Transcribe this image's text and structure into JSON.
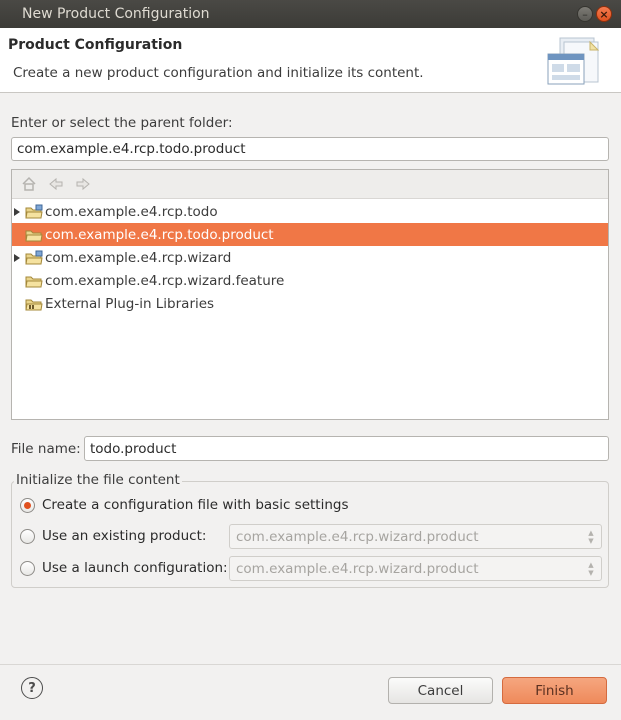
{
  "window": {
    "title": "New Product Configuration",
    "minimize_glyph": "–",
    "close_glyph": "×"
  },
  "header": {
    "title": "Product Configuration",
    "description": "Create a new product configuration and initialize its content.",
    "icon": "wizard-banner-icon"
  },
  "parent_folder": {
    "label": "Enter or select the parent folder:",
    "value": "com.example.e4.rcp.todo.product"
  },
  "tree": {
    "toolbar": [
      "home-icon",
      "back-arrow-icon",
      "forward-arrow-icon"
    ],
    "items": [
      {
        "label": "com.example.e4.rcp.todo",
        "expandable": true,
        "selected": false,
        "icon": "project-folder-icon"
      },
      {
        "label": "com.example.e4.rcp.todo.product",
        "expandable": false,
        "selected": true,
        "icon": "project-folder-icon"
      },
      {
        "label": "com.example.e4.rcp.wizard",
        "expandable": true,
        "selected": false,
        "icon": "project-folder-icon"
      },
      {
        "label": "com.example.e4.rcp.wizard.feature",
        "expandable": false,
        "selected": false,
        "icon": "project-folder-icon"
      },
      {
        "label": "External Plug-in Libraries",
        "expandable": false,
        "selected": false,
        "icon": "library-folder-icon"
      }
    ]
  },
  "file_name": {
    "label": "File name:",
    "value": "todo.product"
  },
  "init_group": {
    "legend": "Initialize the file content",
    "options": [
      {
        "label": "Create a configuration file with basic settings",
        "checked": true
      },
      {
        "label": "Use an existing product:",
        "checked": false,
        "combo_value": "com.example.e4.rcp.wizard.product"
      },
      {
        "label": "Use a launch configuration:",
        "checked": false,
        "combo_value": "com.example.e4.rcp.wizard.product"
      }
    ]
  },
  "footer": {
    "help_glyph": "?",
    "cancel_label": "Cancel",
    "finish_label": "Finish"
  },
  "colors": {
    "selection": "#f07746",
    "finish_button": "#ef8a5b",
    "titlebar": "#3c3b37"
  }
}
